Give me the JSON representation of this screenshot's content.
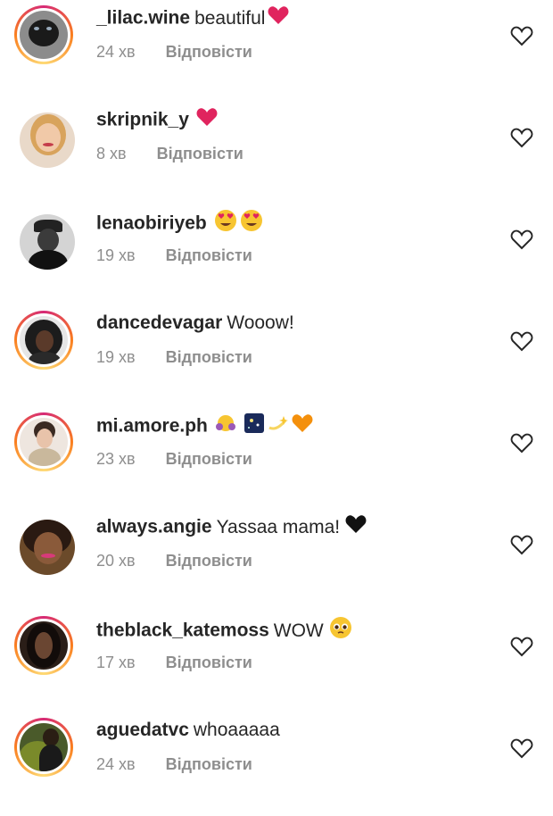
{
  "comments": [
    {
      "username": "_lilac.wine",
      "text": "beautiful",
      "emoji": [
        "red-heart"
      ],
      "time": "24 хв",
      "reply": "Відповісти"
    },
    {
      "username": "skripnik_y",
      "text": "",
      "emoji": [
        "red-heart"
      ],
      "time": "8 хв",
      "reply": "Відповісти"
    },
    {
      "username": "lenaobiriyeb",
      "text": "",
      "emoji": [
        "heart-eyes",
        "heart-eyes"
      ],
      "time": "19 хв",
      "reply": "Відповісти"
    },
    {
      "username": "dancedevagar",
      "text": "Wooow!",
      "emoji": [],
      "time": "19 хв",
      "reply": "Відповісти"
    },
    {
      "username": "mi.amore.ph",
      "text": "",
      "emoji": [
        "hugging-face",
        "night-sky",
        "dizzy",
        "orange-heart"
      ],
      "time": "23 хв",
      "reply": "Відповісти"
    },
    {
      "username": "always.angie",
      "text": "Yassaa mama!",
      "emoji": [
        "black-heart"
      ],
      "time": "20 хв",
      "reply": "Відповісти"
    },
    {
      "username": "theblack_katemoss",
      "text": "WOW",
      "emoji": [
        "pleading-face"
      ],
      "time": "17 хв",
      "reply": "Відповісти"
    },
    {
      "username": "aguedatvc",
      "text": "whoaaaaa",
      "emoji": [],
      "time": "24 хв",
      "reply": "Відповісти"
    }
  ],
  "icons": {
    "like": "heart-outline-icon"
  },
  "colors": {
    "username": "#262626",
    "meta": "#8e8e8e",
    "ring_start": "#d62976",
    "ring_end": "#feda75"
  }
}
